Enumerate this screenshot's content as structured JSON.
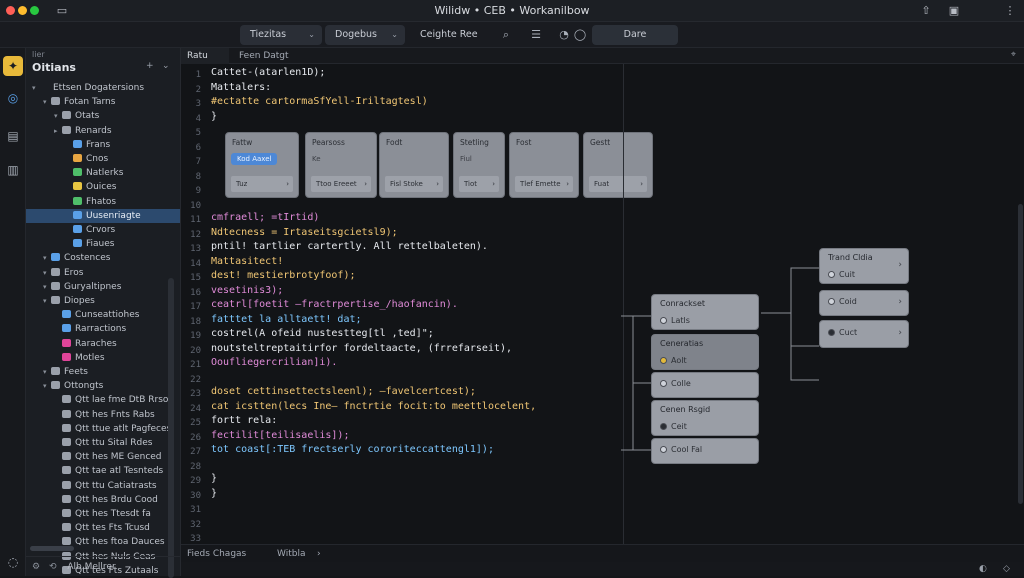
{
  "window": {
    "title": "Wilidw • CEB • Workanilbow"
  },
  "toolbar": {
    "btn1": "Tiezitas",
    "btn2": "Dogebus",
    "btn3": "Ceighte Ree",
    "btn4": "Dare"
  },
  "sidebar": {
    "label": "lier",
    "header": "Oitians",
    "items": [
      {
        "label": "Ettsen Dogatersions",
        "depth": 0,
        "twisty": "▾",
        "color": ""
      },
      {
        "label": "Fotan Tarns",
        "depth": 1,
        "twisty": "▾",
        "color": "#9aa0aa"
      },
      {
        "label": "Otats",
        "depth": 2,
        "twisty": "▾",
        "color": "#9aa0aa"
      },
      {
        "label": "Renards",
        "depth": 2,
        "twisty": "▸",
        "color": "#9aa0aa"
      },
      {
        "label": "Frans",
        "depth": 3,
        "twisty": "",
        "color": "#5aa0e8"
      },
      {
        "label": "Cnos",
        "depth": 3,
        "twisty": "",
        "color": "#e8a642"
      },
      {
        "label": "Natlerks",
        "depth": 3,
        "twisty": "",
        "color": "#4fbf6a"
      },
      {
        "label": "Ouices",
        "depth": 3,
        "twisty": "",
        "color": "#e8c642"
      },
      {
        "label": "Fhatos",
        "depth": 3,
        "twisty": "",
        "color": "#4fbf6a"
      },
      {
        "label": "Uusenriagte",
        "depth": 3,
        "twisty": "",
        "color": "#5aa0e8"
      },
      {
        "label": "Crvors",
        "depth": 3,
        "twisty": "",
        "color": "#5aa0e8"
      },
      {
        "label": "Fiaues",
        "depth": 3,
        "twisty": "",
        "color": "#5aa0e8"
      },
      {
        "label": "Costences",
        "depth": 1,
        "twisty": "▾",
        "color": "#5aa0e8"
      },
      {
        "label": "Eros",
        "depth": 1,
        "twisty": "▾",
        "color": "#9aa0aa"
      },
      {
        "label": "Guryaltipnes",
        "depth": 1,
        "twisty": "▾",
        "color": "#9aa0aa"
      },
      {
        "label": "Diopes",
        "depth": 1,
        "twisty": "▾",
        "color": "#9aa0aa"
      },
      {
        "label": "Cunseattiohes",
        "depth": 2,
        "twisty": "",
        "color": "#5aa0e8"
      },
      {
        "label": "Rarractions",
        "depth": 2,
        "twisty": "",
        "color": "#5aa0e8"
      },
      {
        "label": "Raraches",
        "depth": 2,
        "twisty": "",
        "color": "#e0459a"
      },
      {
        "label": "Motles",
        "depth": 2,
        "twisty": "",
        "color": "#e0459a"
      },
      {
        "label": "Feets",
        "depth": 1,
        "twisty": "▾",
        "color": "#9aa0aa"
      },
      {
        "label": "Ottongts",
        "depth": 1,
        "twisty": "▾",
        "color": "#9aa0aa"
      },
      {
        "label": "Qtt lae fme DtB Rrsoc",
        "depth": 2,
        "twisty": "",
        "color": "#9aa0aa"
      },
      {
        "label": "Qtt hes Fnts Rabs",
        "depth": 2,
        "twisty": "",
        "color": "#9aa0aa"
      },
      {
        "label": "Qtt ttue atlt Pagfeces",
        "depth": 2,
        "twisty": "",
        "color": "#9aa0aa"
      },
      {
        "label": "Qtt ttu Sital Rdes",
        "depth": 2,
        "twisty": "",
        "color": "#9aa0aa"
      },
      {
        "label": "Qtt hes ME Genced",
        "depth": 2,
        "twisty": "",
        "color": "#9aa0aa"
      },
      {
        "label": "Qtt tae atl Tesnteds",
        "depth": 2,
        "twisty": "",
        "color": "#9aa0aa"
      },
      {
        "label": "Qtt ttu Catiatrasts",
        "depth": 2,
        "twisty": "",
        "color": "#9aa0aa"
      },
      {
        "label": "Qtt hes Brdu Cood",
        "depth": 2,
        "twisty": "",
        "color": "#9aa0aa"
      },
      {
        "label": "Qtt hes Ttesdt fa",
        "depth": 2,
        "twisty": "",
        "color": "#9aa0aa"
      },
      {
        "label": "Qtt tes Fts Tcusd",
        "depth": 2,
        "twisty": "",
        "color": "#9aa0aa"
      },
      {
        "label": "Qtt hes ftoa Dauces",
        "depth": 2,
        "twisty": "",
        "color": "#9aa0aa"
      },
      {
        "label": "Qtt hes Nuls Ceas",
        "depth": 2,
        "twisty": "",
        "color": "#9aa0aa"
      },
      {
        "label": "Qtt tes Fts Zutaals",
        "depth": 2,
        "twisty": "",
        "color": "#9aa0aa"
      }
    ],
    "footer": "Alb Mellrer"
  },
  "editor": {
    "tabs": [
      "Ratu",
      "Feen Datgt"
    ],
    "line_numbers": [
      "1",
      "2",
      "3",
      "4",
      "5",
      "6",
      "7",
      "8",
      "9",
      "10",
      "11",
      "12",
      "13",
      "14",
      "15",
      "16",
      "17",
      "18",
      "19",
      "20",
      "21",
      "22",
      "23",
      "24",
      "25",
      "26",
      "27",
      "28",
      "29",
      "30",
      "31",
      "32",
      "33"
    ],
    "code": [
      {
        "text": "Cattet-(atarlen1D);",
        "cls": "w"
      },
      {
        "text": "Mattalers:",
        "cls": "w"
      },
      {
        "text": "  #ectatte cartormaSfYell-Iriltagtesl)",
        "cls": "s"
      },
      {
        "text": "}",
        "cls": "w"
      },
      {
        "text": "cmfraell; =tIrtid)",
        "cls": "p"
      },
      {
        "text": "  Ndtecness = Irtaseitsgcietsl9);",
        "cls": "s"
      },
      {
        "text": "  pntil! tartlier cartertly. All rettelbaleten).",
        "cls": "w"
      },
      {
        "text": "  Mattasitect!",
        "cls": "s"
      },
      {
        "text": "  dest! mestierbrotyfoof);",
        "cls": "s"
      },
      {
        "text": "    vesetinis3);",
        "cls": "p"
      },
      {
        "text": "    ceatrl[foetit –fractrpertise_/haofancin).",
        "cls": "p"
      },
      {
        "text": "    fatttet la alltaett! dat;",
        "cls": "k"
      },
      {
        "text": "      costrel(A ofeid nustestteg[tl ,ted]\";",
        "cls": "w"
      },
      {
        "text": "      noutsteltreptaitirfor fordeltaacte, (frrefarseit),",
        "cls": "w"
      },
      {
        "text": "      Ooufliegercrilian]i).",
        "cls": "p"
      },
      {
        "text": "  doset cettinsettectsleenl); –favelcertcest);",
        "cls": "s"
      },
      {
        "text": "    cat icstten(lecs Ine– fnctrtie focit:to meettlocelent,",
        "cls": "s"
      },
      {
        "text": "    fortt rela:",
        "cls": "w"
      },
      {
        "text": "    fectilit[teilisaelis]);",
        "cls": "p"
      },
      {
        "text": "    tot coast[:TEB frectserly cororiteccattengl1]);",
        "cls": "k"
      },
      {
        "text": "}",
        "cls": "w"
      },
      {
        "text": "}",
        "cls": "w"
      }
    ],
    "cards": [
      {
        "title": "Fattw",
        "chip": "Kod Aaxel",
        "bottom": "Tuz"
      },
      {
        "title": "Pearsoss",
        "sub": "Ke",
        "bottom": "Ttoo Ereeet"
      },
      {
        "title": "Fodt",
        "sub": "",
        "bottom": "Fisl Stoke"
      },
      {
        "title": "Stetling",
        "sub": "Fiul",
        "bottom": "Tiot"
      },
      {
        "title": "Fost",
        "sub": "",
        "bottom": "Tlef Emette"
      },
      {
        "title": "Gestt",
        "sub": "",
        "bottom": "Fuat"
      }
    ],
    "nodes": [
      {
        "title": "Conrackset",
        "detail": "Latls",
        "dot": "#cfd3da"
      },
      {
        "title": "Ceneratias",
        "detail": "Aolt",
        "dot": "#e2b93b"
      },
      {
        "title": "",
        "detail": "Colle",
        "dot": "#cfd3da"
      },
      {
        "title": "Cenen Rsgid",
        "detail": "Ceit",
        "dot": "#2a2d33"
      },
      {
        "title": "",
        "detail": "Cool Fal",
        "dot": "#cfd3da"
      },
      {
        "title": "Trand Cldia",
        "detail": "Cuit",
        "dot": "#cfd3da"
      },
      {
        "title": "",
        "detail": "Coid",
        "dot": "#cfd3da"
      },
      {
        "title": "",
        "detail": "Cuct",
        "dot": "#2a2d33"
      }
    ],
    "bottom_tabs": [
      "Fieds Chagas",
      "Witbla"
    ]
  }
}
